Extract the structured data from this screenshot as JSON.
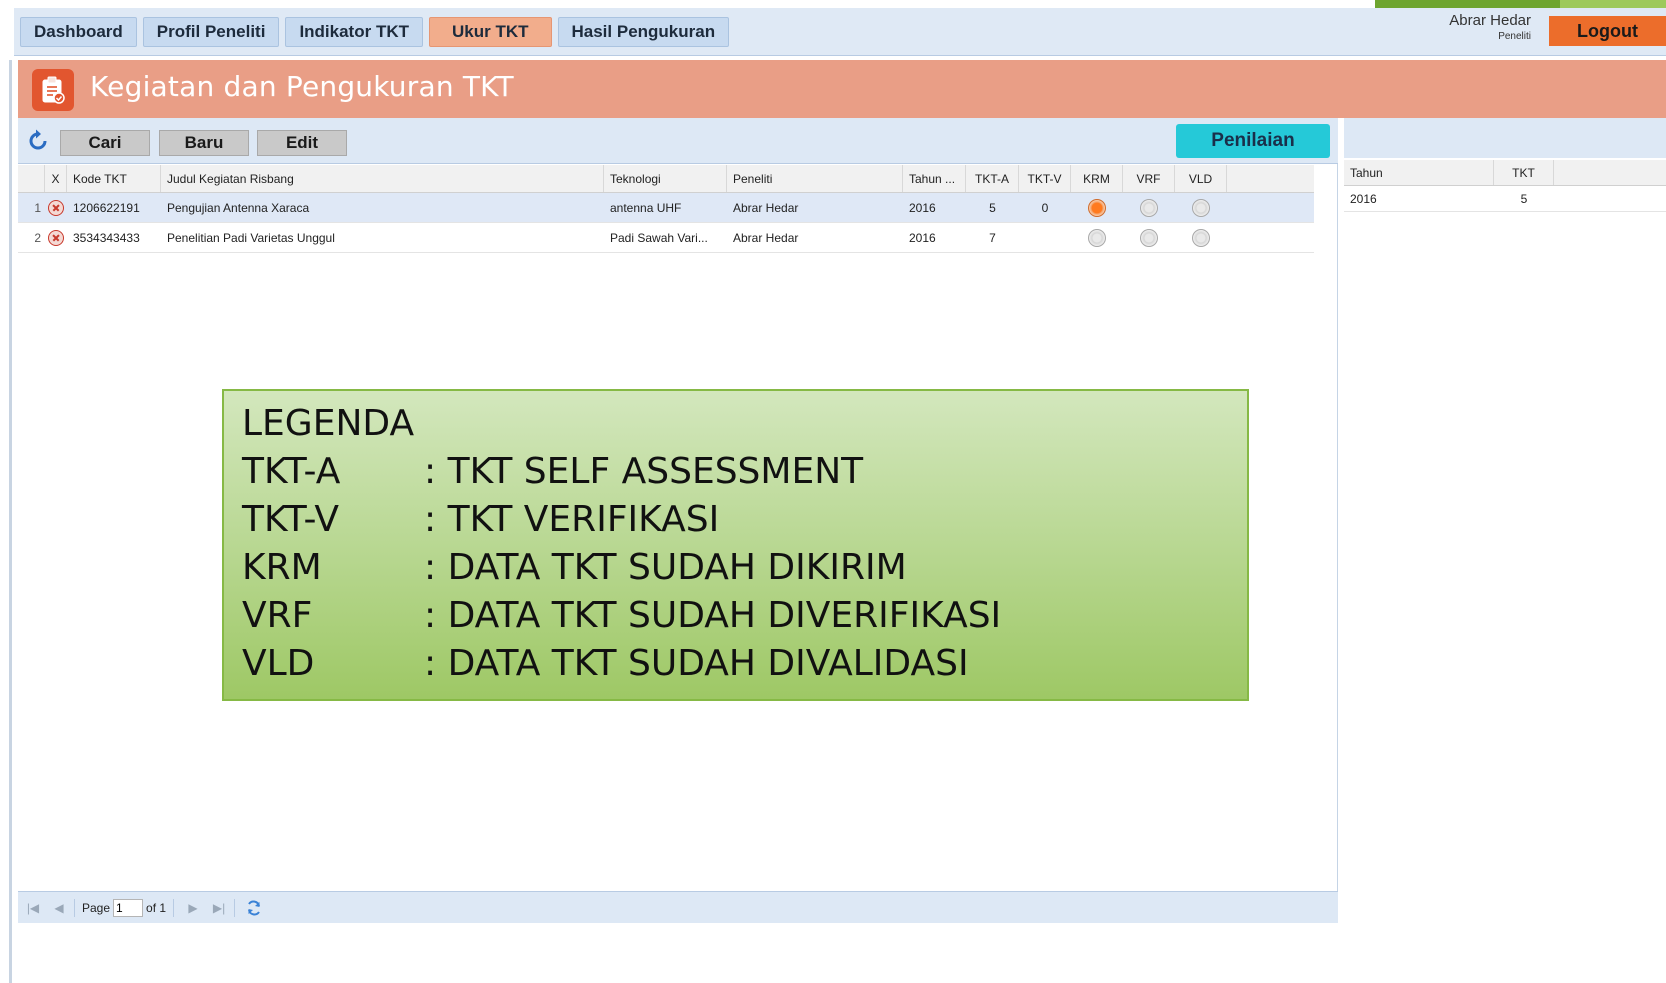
{
  "nav": {
    "tabs": [
      {
        "label": "Dashboard"
      },
      {
        "label": "Profil Peneliti"
      },
      {
        "label": "Indikator TKT"
      },
      {
        "label": "Ukur TKT"
      },
      {
        "label": "Hasil Pengukuran"
      }
    ],
    "active_tab": "Ukur TKT"
  },
  "user": {
    "name": "Abrar Hedar",
    "role": "Peneliti",
    "logout_label": "Logout"
  },
  "page": {
    "title": "Kegiatan dan Pengukuran TKT",
    "title_icon": "clipboard-check-icon"
  },
  "toolbar": {
    "refresh_icon": "refresh-icon",
    "cari_label": "Cari",
    "baru_label": "Baru",
    "edit_label": "Edit",
    "penilaian_label": "Penilaian"
  },
  "grid": {
    "columns": [
      "X",
      "Kode TKT",
      "Judul Kegiatan Risbang",
      "Teknologi",
      "Peneliti",
      "Tahun ...",
      "TKT-A",
      "TKT-V",
      "KRM",
      "VRF",
      "VLD"
    ],
    "rows": [
      {
        "no": "1",
        "kode": "1206622191",
        "judul": "Pengujian Antenna Xaraca",
        "teknologi": "antenna UHF",
        "peneliti": "Abrar Hedar",
        "tahun": "2016",
        "tkt_a": "5",
        "tkt_v": "0",
        "krm": true,
        "vrf": false,
        "vld": false
      },
      {
        "no": "2",
        "kode": "3534343433",
        "judul": "Penelitian Padi Varietas Unggul",
        "teknologi": "Padi Sawah Vari...",
        "peneliti": "Abrar Hedar",
        "tahun": "2016",
        "tkt_a": "7",
        "tkt_v": "",
        "krm": false,
        "vrf": false,
        "vld": false
      }
    ]
  },
  "legend": {
    "title": "LEGENDA",
    "items": [
      {
        "key": "TKT-A",
        "desc": ": TKT SELF ASSESSMENT"
      },
      {
        "key": "TKT-V",
        "desc": ": TKT VERIFIKASI"
      },
      {
        "key": "KRM",
        "desc": ": DATA TKT SUDAH DIKIRIM"
      },
      {
        "key": "VRF",
        "desc": ": DATA TKT SUDAH DIVERIFIKASI"
      },
      {
        "key": "VLD",
        "desc": ": DATA TKT SUDAH DIVALIDASI"
      }
    ]
  },
  "pager": {
    "page_label": "Page",
    "page_value": "1",
    "of_label": "of 1"
  },
  "side_grid": {
    "columns": [
      "Tahun",
      "TKT"
    ],
    "rows": [
      {
        "tahun": "2016",
        "tkt": "5"
      }
    ]
  },
  "colors": {
    "accent": "#ec6d2b",
    "title_band": "#e99e86",
    "penilaian": "#25c9d8",
    "legend_green": "#9ec865"
  }
}
